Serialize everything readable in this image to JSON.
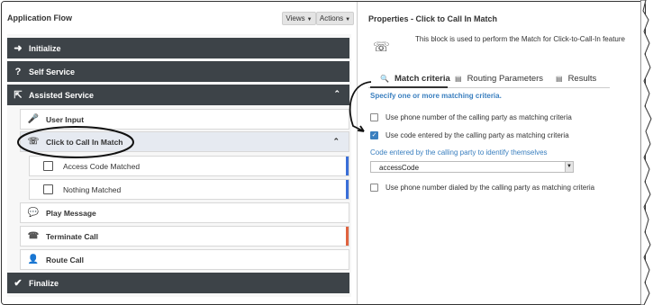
{
  "left": {
    "title": "Application Flow",
    "views_label": "Views",
    "actions_label": "Actions",
    "items": [
      {
        "label": "Initialize",
        "icon": "sign-in-icon"
      },
      {
        "label": "Self Service",
        "icon": "question-icon"
      },
      {
        "label": "Assisted Service",
        "icon": "share-icon"
      },
      {
        "label": "User Input",
        "icon": "microphone-icon"
      },
      {
        "label": "Click to Call In Match",
        "icon": "phone-transfer-icon"
      },
      {
        "label": "Access Code Matched"
      },
      {
        "label": "Nothing Matched"
      },
      {
        "label": "Play Message",
        "icon": "speech-bubble-icon"
      },
      {
        "label": "Terminate Call",
        "icon": "phone-end-icon"
      },
      {
        "label": "Route Call",
        "icon": "agent-icon"
      },
      {
        "label": "Finalize",
        "icon": "check-icon"
      }
    ],
    "bar_colors": {
      "blue": "#3a6fd8",
      "red": "#e0633f"
    }
  },
  "right": {
    "title": "Properties - Click to Call In Match",
    "description": "This block is used to perform the Match for Click-to-Call-In feature",
    "tabs": [
      {
        "label": "Match criteria",
        "icon": "search-icon"
      },
      {
        "label": "Routing Parameters",
        "icon": "calendar-icon"
      },
      {
        "label": "Results",
        "icon": "calendar-icon"
      }
    ],
    "spec_text": "Specify one or more matching criteria.",
    "options": [
      {
        "label": "Use phone number of the calling party as matching criteria",
        "checked": false
      },
      {
        "label": "Use code entered by the calling party as matching criteria",
        "checked": true
      }
    ],
    "code_label": "Code entered by the calling party to identify themselves",
    "code_value": "accessCode",
    "option3": {
      "label": "Use phone number dialed by the calling party as matching criteria",
      "checked": false
    }
  }
}
